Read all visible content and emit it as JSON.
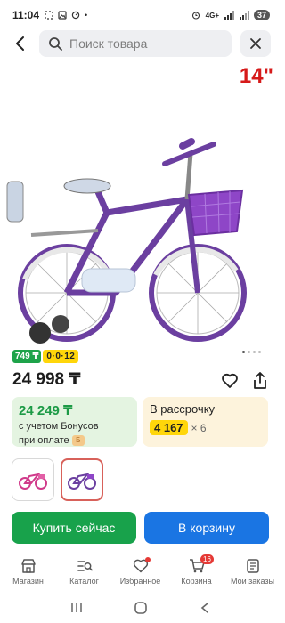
{
  "status_bar": {
    "time": "11:04",
    "battery": "37",
    "network": "4G+"
  },
  "search": {
    "placeholder": "Поиск товара"
  },
  "product": {
    "size_label": "14\"",
    "badge_installment": "749 ₸",
    "badge_plan": "0·0·12",
    "price": "24 998 ₸",
    "image_count": 4,
    "active_image": 1
  },
  "bonus_card": {
    "price": "24 249 ₸",
    "line1": "с учетом Бонусов",
    "line2": "при оплате"
  },
  "credit_card": {
    "title": "В рассрочку",
    "monthly": "4 167",
    "multiplier": "× 6"
  },
  "actions": {
    "buy_now": "Купить сейчас",
    "add_to_cart": "В корзину"
  },
  "bottom_nav": {
    "items": [
      {
        "label": "Магазин",
        "icon": "store-icon"
      },
      {
        "label": "Каталог",
        "icon": "catalog-icon"
      },
      {
        "label": "Избранное",
        "icon": "heart-icon"
      },
      {
        "label": "Корзина",
        "icon": "cart-icon"
      },
      {
        "label": "Мои заказы",
        "icon": "orders-icon"
      }
    ],
    "cart_count": "16"
  },
  "colors": {
    "green": "#18a24b",
    "blue": "#1a75e3",
    "yellow": "#ffd60a",
    "red": "#d61a1a"
  }
}
